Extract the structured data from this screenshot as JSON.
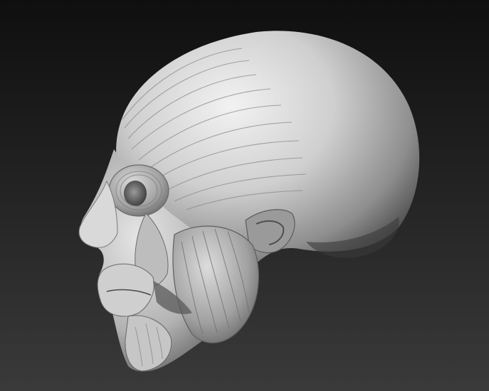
{
  "scene": {
    "subject_icon": "anatomical-head-render",
    "colors": {
      "background_top": "#0f0f0f",
      "background_bottom": "#3a3a3a",
      "material_light": "#ededed",
      "material_mid": "#a9a9a9",
      "material_dark": "#4a4a4a"
    }
  }
}
